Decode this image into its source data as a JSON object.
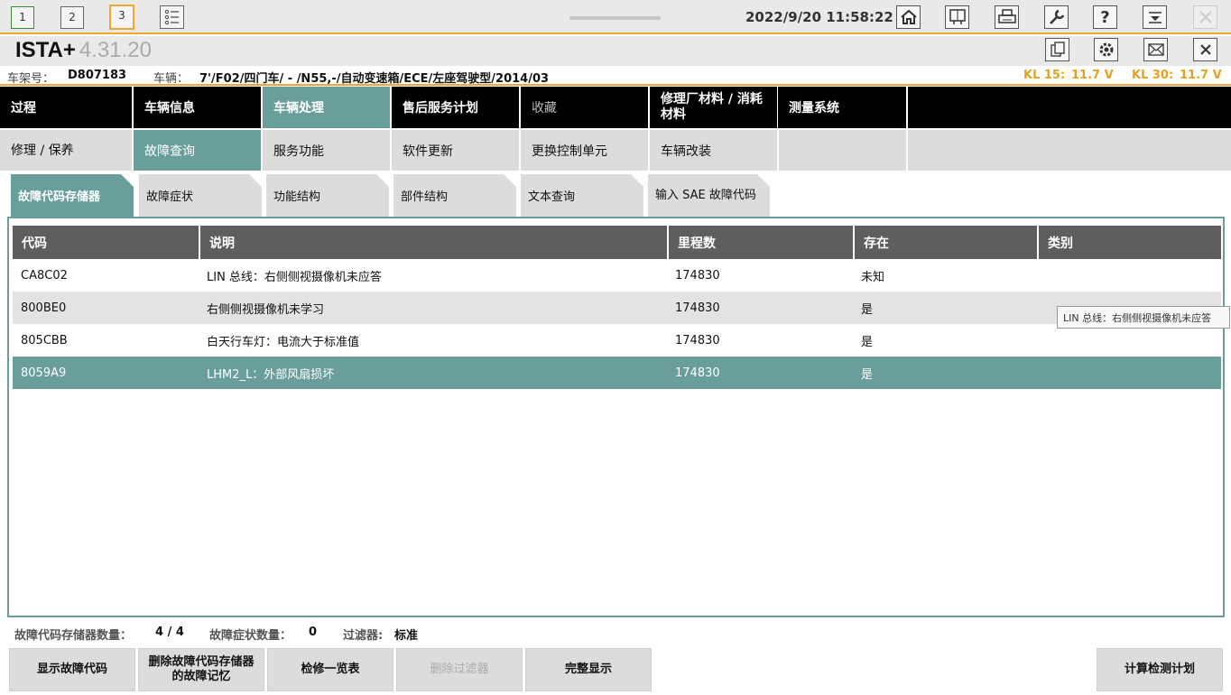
{
  "window": {
    "buttons": [
      "1",
      "2",
      "3"
    ],
    "datetime": "2022/9/20 11:58:22"
  },
  "app": {
    "name": "ISTA+",
    "version": "4.31.20"
  },
  "vehicle": {
    "vin_label": "车架号：",
    "vin": "D807183",
    "car_label": "车辆：",
    "car": "7'/F02/四门车/ - /N55,-/自动变速箱/ECE/左座驾驶型/2014/03",
    "kl15_label": "KL 15:",
    "kl15": "11.7 V",
    "kl30_label": "KL 30:",
    "kl30": "11.7 V"
  },
  "nav1": [
    "过程",
    "车辆信息",
    "车辆处理",
    "售后服务计划",
    "收藏",
    "修理厂材料 / 消耗材料",
    "测量系统"
  ],
  "nav2": [
    "修理 / 保养",
    "故障查询",
    "服务功能",
    "软件更新",
    "更换控制单元",
    "车辆改装"
  ],
  "tabs": [
    "故障代码存储器",
    "故障症状",
    "功能结构",
    "部件结构",
    "文本查询",
    "输入 SAE 故障代码"
  ],
  "table": {
    "headers": [
      "代码",
      "说明",
      "里程数",
      "存在",
      "类别"
    ],
    "rows": [
      [
        "CA8C02",
        "LIN 总线：右侧侧视摄像机未应答",
        "174830",
        "未知",
        ""
      ],
      [
        "800BE0",
        "右侧侧视摄像机未学习",
        "174830",
        "是",
        ""
      ],
      [
        "805CBB",
        "白天行车灯：电流大于标准值",
        "174830",
        "是",
        ""
      ],
      [
        "8059A9",
        "LHM2_L：外部风扇损坏",
        "174830",
        "是",
        ""
      ]
    ]
  },
  "tooltip": "LIN 总线：右侧侧视摄像机未应答",
  "status": {
    "fault_count_label": "故障代码存储器数量：",
    "fault_count": "4 / 4",
    "symptom_count_label": "故障症状数量：",
    "symptom_count": "0",
    "filter_label": "过滤器:",
    "filter": "标准"
  },
  "bottom_buttons": {
    "show": "显示故障代码",
    "delete_line1": "删除故障代码存储器",
    "delete_line2": "的故障记忆",
    "repair_list": "检修一览表",
    "delete_filter": "删除过滤器",
    "full_display": "完整显示",
    "calc_plan": "计算检测计划"
  }
}
